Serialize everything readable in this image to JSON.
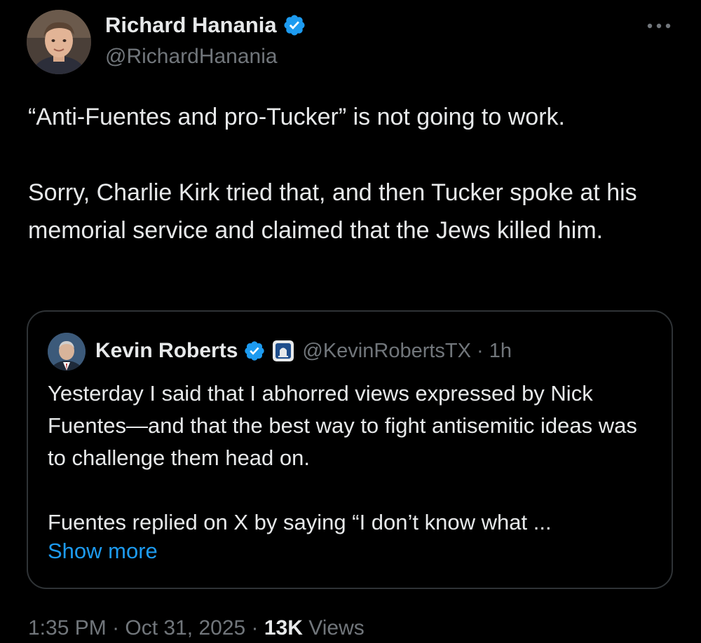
{
  "tweet": {
    "author": {
      "name": "Richard Hanania",
      "handle": "@RichardHanania"
    },
    "text": {
      "p1": "“Anti-Fuentes and pro-Tucker” is not going to work.",
      "p2": "Sorry, Charlie Kirk tried that, and then Tucker spoke at his memorial service and claimed that the Jews killed him."
    },
    "footer": {
      "time": "1:35 PM",
      "sep1": " · ",
      "date": "Oct 31, 2025",
      "sep2": " · ",
      "views_count": "13K",
      "views_label": " Views"
    }
  },
  "quote": {
    "name": "Kevin Roberts",
    "handle_time": "@KevinRobertsTX · 1h",
    "text": {
      "p1": "Yesterday I said that I abhorred views expressed by Nick Fuentes—and that the best way to fight antisemitic ideas was to challenge them head on.",
      "p2": "Fuentes replied on X by saying “I don’t know what ..."
    },
    "show_more": "Show more"
  },
  "colors": {
    "background": "#000000",
    "text": "#e7e9ea",
    "secondary": "#71767b",
    "accent": "#1d9bf0",
    "border": "#2f3336"
  },
  "icons": [
    "verified-badge-icon",
    "more-options-icon",
    "affiliate-badge-icon"
  ]
}
